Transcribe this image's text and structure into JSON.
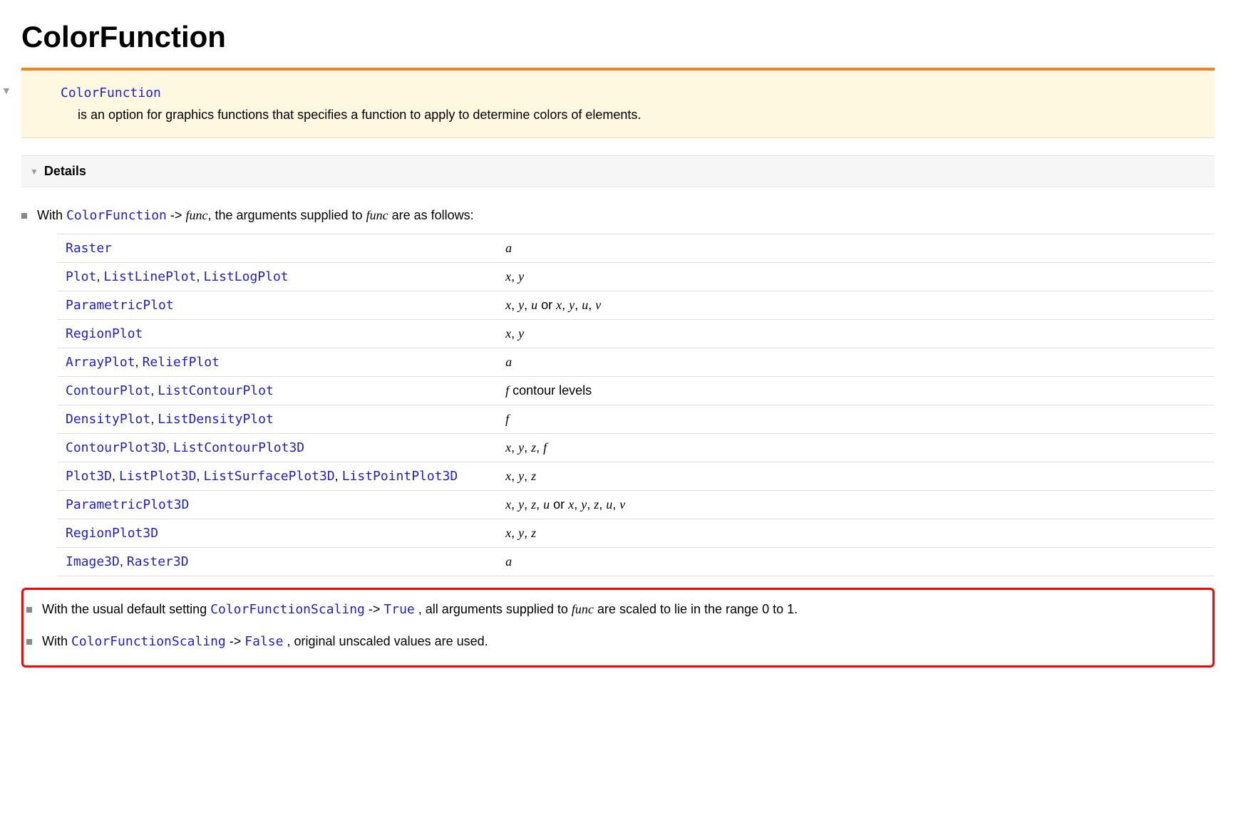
{
  "header": {
    "title": "ColorFunction"
  },
  "summary": {
    "name": "ColorFunction",
    "description": "is an option for graphics functions that specifies a function to apply to determine colors of elements."
  },
  "details_section": {
    "label": "Details"
  },
  "intro_bullet": {
    "pre": "With ",
    "symbol": "ColorFunction",
    "mid1": " -> ",
    "func": "func",
    "mid2": ", the arguments supplied to ",
    "func2": "func",
    "post": " are as follows:"
  },
  "table_rows": [
    {
      "symbols": [
        "Raster"
      ],
      "args_html": "<span class='ital'>a</span>"
    },
    {
      "symbols": [
        "Plot",
        "ListLinePlot",
        "ListLogPlot"
      ],
      "args_html": "<span class='ital'>x</span>, <span class='ital'>y</span>"
    },
    {
      "symbols": [
        "ParametricPlot"
      ],
      "args_html": "<span class='ital'>x</span>, <span class='ital'>y</span>, <span class='ital'>u</span> or <span class='ital'>x</span>, <span class='ital'>y</span>, <span class='ital'>u</span>, <span class='ital'>v</span>"
    },
    {
      "symbols": [
        "RegionPlot"
      ],
      "args_html": "<span class='ital'>x</span>, <span class='ital'>y</span>"
    },
    {
      "symbols": [
        "ArrayPlot",
        "ReliefPlot"
      ],
      "args_html": "<span class='ital'>a</span>"
    },
    {
      "symbols": [
        "ContourPlot",
        "ListContourPlot"
      ],
      "args_html": "<span class='ital'>f</span> contour levels"
    },
    {
      "symbols": [
        "DensityPlot",
        "ListDensityPlot"
      ],
      "args_html": "<span class='ital'>f</span>"
    },
    {
      "symbols": [
        "ContourPlot3D",
        "ListContourPlot3D"
      ],
      "args_html": "<span class='ital'>x</span>, <span class='ital'>y</span>, <span class='ital'>z</span>, <span class='ital'>f</span>"
    },
    {
      "symbols": [
        "Plot3D",
        "ListPlot3D",
        "ListSurfacePlot3D",
        "ListPointPlot3D"
      ],
      "args_html": "<span class='ital'>x</span>, <span class='ital'>y</span>, <span class='ital'>z</span>"
    },
    {
      "symbols": [
        "ParametricPlot3D"
      ],
      "args_html": "<span class='ital'>x</span>, <span class='ital'>y</span>, <span class='ital'>z</span>, <span class='ital'>u</span> or <span class='ital'>x</span>, <span class='ital'>y</span>, <span class='ital'>z</span>, <span class='ital'>u</span>, <span class='ital'>v</span>"
    },
    {
      "symbols": [
        "RegionPlot3D"
      ],
      "args_html": "<span class='ital'>x</span>, <span class='ital'>y</span>, <span class='ital'>z</span>"
    },
    {
      "symbols": [
        "Image3D",
        "Raster3D"
      ],
      "args_html": "<span class='ital'>a</span>"
    }
  ],
  "hl_bullet1": {
    "pre": "With the usual default setting ",
    "sym": "ColorFunctionScaling",
    "mid1": " -> ",
    "val": "True",
    "mid2": ", all arguments supplied to ",
    "func": "func",
    "post": " are scaled to lie in the range 0 to 1."
  },
  "hl_bullet2": {
    "pre": "With ",
    "sym": "ColorFunctionScaling",
    "mid1": " -> ",
    "val": "False",
    "post": ", original unscaled values are used."
  }
}
